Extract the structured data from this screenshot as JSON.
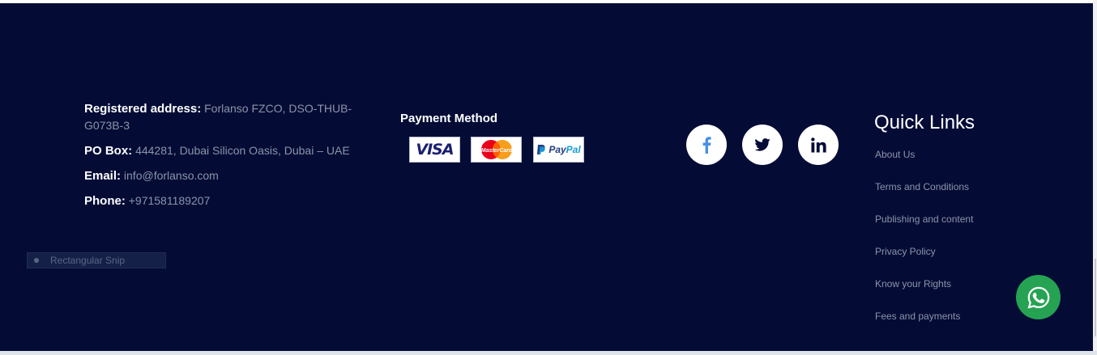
{
  "contact": {
    "address_label": "Registered address:",
    "address_value": "Forlanso FZCO, DSO-THUB-G073B-3",
    "pobox_label": "PO Box:",
    "pobox_value": "444281, Dubai Silicon Oasis, Dubai – UAE",
    "email_label": "Email:",
    "email_value": "info@forlanso.com",
    "phone_label": "Phone:",
    "phone_value": "+971581189207"
  },
  "payment": {
    "title": "Payment Method",
    "cards": [
      {
        "name": "VISA",
        "icon": "visa-logo"
      },
      {
        "name": "MasterCard",
        "icon": "mastercard-logo"
      },
      {
        "name_prefix": "Pay",
        "name_suffix": "Pal",
        "icon": "paypal-logo"
      }
    ]
  },
  "social": {
    "icons": [
      "facebook-icon",
      "twitter-icon",
      "linkedin-icon"
    ],
    "facebook_color": "#4a90e2",
    "icon_color": "#040c36"
  },
  "quick_links": {
    "title": "Quick Links",
    "items": [
      {
        "label": "About Us"
      },
      {
        "label": "Terms and Conditions"
      },
      {
        "label": "Publishing and content"
      },
      {
        "label": "Privacy Policy"
      },
      {
        "label": "Know your Rights"
      },
      {
        "label": "Fees and payments"
      }
    ]
  },
  "overlay": {
    "snip_label": "Rectangular Snip",
    "whatsapp_icon": "whatsapp-icon"
  },
  "colors": {
    "background": "#040c36",
    "muted_text": "#8d93a8",
    "heading_text": "#ffffff",
    "whatsapp_green": "#25a352"
  }
}
